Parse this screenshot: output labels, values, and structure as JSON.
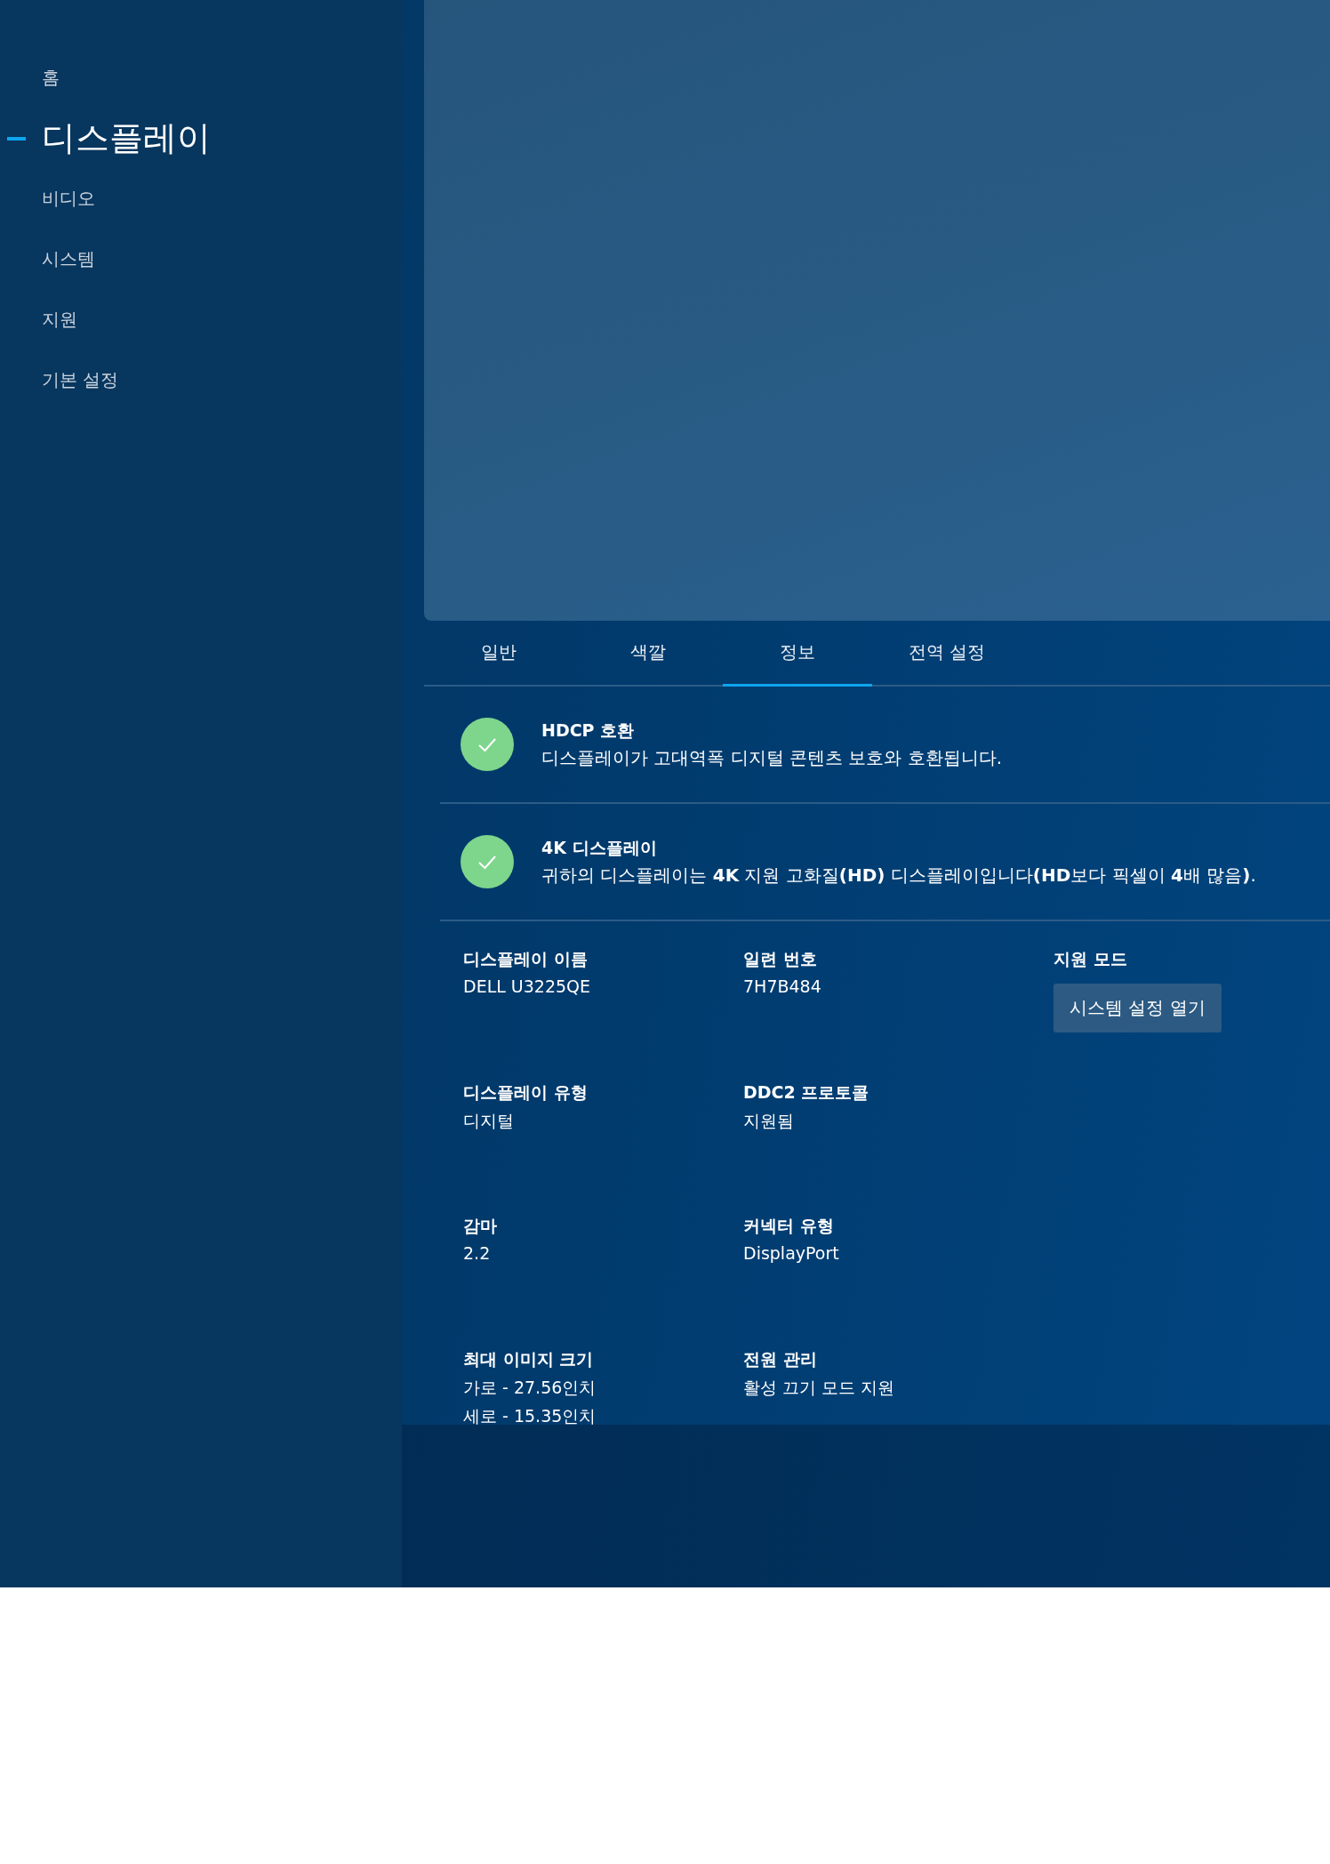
{
  "sidebar": {
    "items": [
      {
        "label": "홈",
        "selected": false
      },
      {
        "label": "디스플레이",
        "selected": true
      },
      {
        "label": "비디오",
        "selected": false
      },
      {
        "label": "시스템",
        "selected": false
      },
      {
        "label": "지원",
        "selected": false
      },
      {
        "label": "기본 설정",
        "selected": false
      }
    ]
  },
  "tabs": [
    {
      "label": "일반",
      "selected": false
    },
    {
      "label": "색깔",
      "selected": false
    },
    {
      "label": "정보",
      "selected": true
    },
    {
      "label": "전역 설정",
      "selected": false
    }
  ],
  "features": [
    {
      "title": "HDCP 호환",
      "description": "디스플레이가 고대역폭 디지털 콘텐츠 보호와 호환됩니다.",
      "checked": true
    },
    {
      "title": "4K 디스플레이",
      "description": "귀하의 디스플레이는 **4K** 지원 고화질**(HD)** 디스플레이입니다**(HD**보다 픽셀이 **4**배 많음**)**.",
      "checked": true
    }
  ],
  "info": [
    {
      "label": "디스플레이 이름",
      "values": [
        "DELL U3225QE"
      ]
    },
    {
      "label": "일련 번호",
      "values": [
        "7H7B484"
      ]
    },
    {
      "label": "지원 모드",
      "button": "시스템 설정 열기"
    },
    {
      "label": "디스플레이 유형",
      "values": [
        "디지털"
      ]
    },
    {
      "label": "DDC2 프로토콜",
      "values": [
        "지원됨"
      ]
    },
    {
      "label": "감마",
      "values": [
        "2.2"
      ]
    },
    {
      "label": "커넥터 유형",
      "values": [
        "DisplayPort"
      ]
    },
    {
      "label": "최대 이미지 크기",
      "values": [
        "가로 - 27.56인치",
        "세로 - 15.35인치"
      ]
    },
    {
      "label": "전원 관리",
      "values": [
        "활성 끄기 모드 지원"
      ]
    }
  ]
}
